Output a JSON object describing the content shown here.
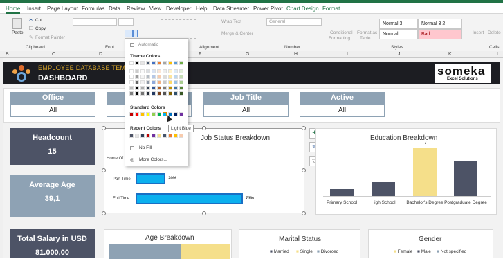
{
  "tabs": [
    "Home",
    "Insert",
    "Page Layout",
    "Formulas",
    "Data",
    "Review",
    "View",
    "Developer",
    "Help",
    "Data Streamer",
    "Power Pivot",
    "Chart Design",
    "Format"
  ],
  "ribbon": {
    "cut": "Cut",
    "copy": "Copy",
    "paste": "Paste",
    "format_painter": "Format Painter",
    "wrap_text": "Wrap Text",
    "merge_center": "Merge & Center",
    "number_format": "General",
    "conditional": "Conditional",
    "formatting": "Formatting",
    "format_as": "Format as",
    "table": "Table",
    "insert": "Insert",
    "delete": "Delete",
    "styles": [
      "Normal 3",
      "Normal 3 2",
      "Normal",
      "Bad"
    ],
    "groups": {
      "clipboard": "Clipboard",
      "font": "Font",
      "alignment": "Alignment",
      "number": "Number",
      "styles": "Styles",
      "cells": "Cells"
    }
  },
  "columns": [
    "B",
    "C",
    "D",
    "E",
    "F",
    "G",
    "H",
    "I",
    "J",
    "K",
    "L"
  ],
  "banner": {
    "subtitle": "EMPLOYEE DATABASE TEMPLA",
    "title": "DASHBOARD",
    "logo_word": "someka",
    "logo_tag": "Excel Solutions"
  },
  "filters": [
    {
      "label": "Office",
      "value": "All"
    },
    {
      "label": "",
      "value": ""
    },
    {
      "label": "Job Title",
      "value": "All"
    },
    {
      "label": "Active",
      "value": "All"
    }
  ],
  "kpis": [
    {
      "label": "Headcount",
      "value": "15",
      "color": "#4d5366"
    },
    {
      "label": "Average Age",
      "value": "39,1",
      "color": "#8ea2b4"
    },
    {
      "label": "Total Salary in USD",
      "value": "81.000,00",
      "color": "#4d5366"
    }
  ],
  "job_chart": {
    "title": "Job Status Breakdown",
    "cat_home": "Home Of",
    "cat_part": "Part Time",
    "cat_full": "Full Time",
    "pct_part": "20%",
    "pct_full": "73%"
  },
  "edu_chart": {
    "title": "Education Breakdown",
    "label_top": "7",
    "cats": [
      "Primary School",
      "High School",
      "Bachelor's Degree",
      "Postgraduate Degree"
    ]
  },
  "age_chart": {
    "title": "Age Breakdown"
  },
  "marital_chart": {
    "title": "Marital Status",
    "legend": [
      "Married",
      "Single",
      "Divorced"
    ]
  },
  "gender_chart": {
    "title": "Gender",
    "legend": [
      "Female",
      "Male",
      "Not specified"
    ]
  },
  "picker": {
    "automatic": "Automatic",
    "theme_colors": "Theme Colors",
    "standard_colors": "Standard Colors",
    "recent_colors": "Recent Colors",
    "no_fill": "No Fill",
    "more_colors": "More Colors...",
    "tooltip": "Light Blue"
  },
  "colors": {
    "accent": "#217346",
    "navy": "#4d5366",
    "steel": "#8ea2b4",
    "gold": "#f5df8a",
    "bar_blue": "#0bb0ee",
    "gold_text": "#d9a62a"
  },
  "chart_data": [
    {
      "type": "bar",
      "title": "Job Status Breakdown",
      "categories": [
        "Part Time",
        "Full Time"
      ],
      "values": [
        20,
        73
      ],
      "xlabel": "",
      "ylabel": ""
    },
    {
      "type": "bar",
      "title": "Education Breakdown",
      "categories": [
        "Primary School",
        "High School",
        "Bachelor's Degree",
        "Postgraduate Degree"
      ],
      "values": [
        1,
        2,
        7,
        5
      ]
    }
  ]
}
